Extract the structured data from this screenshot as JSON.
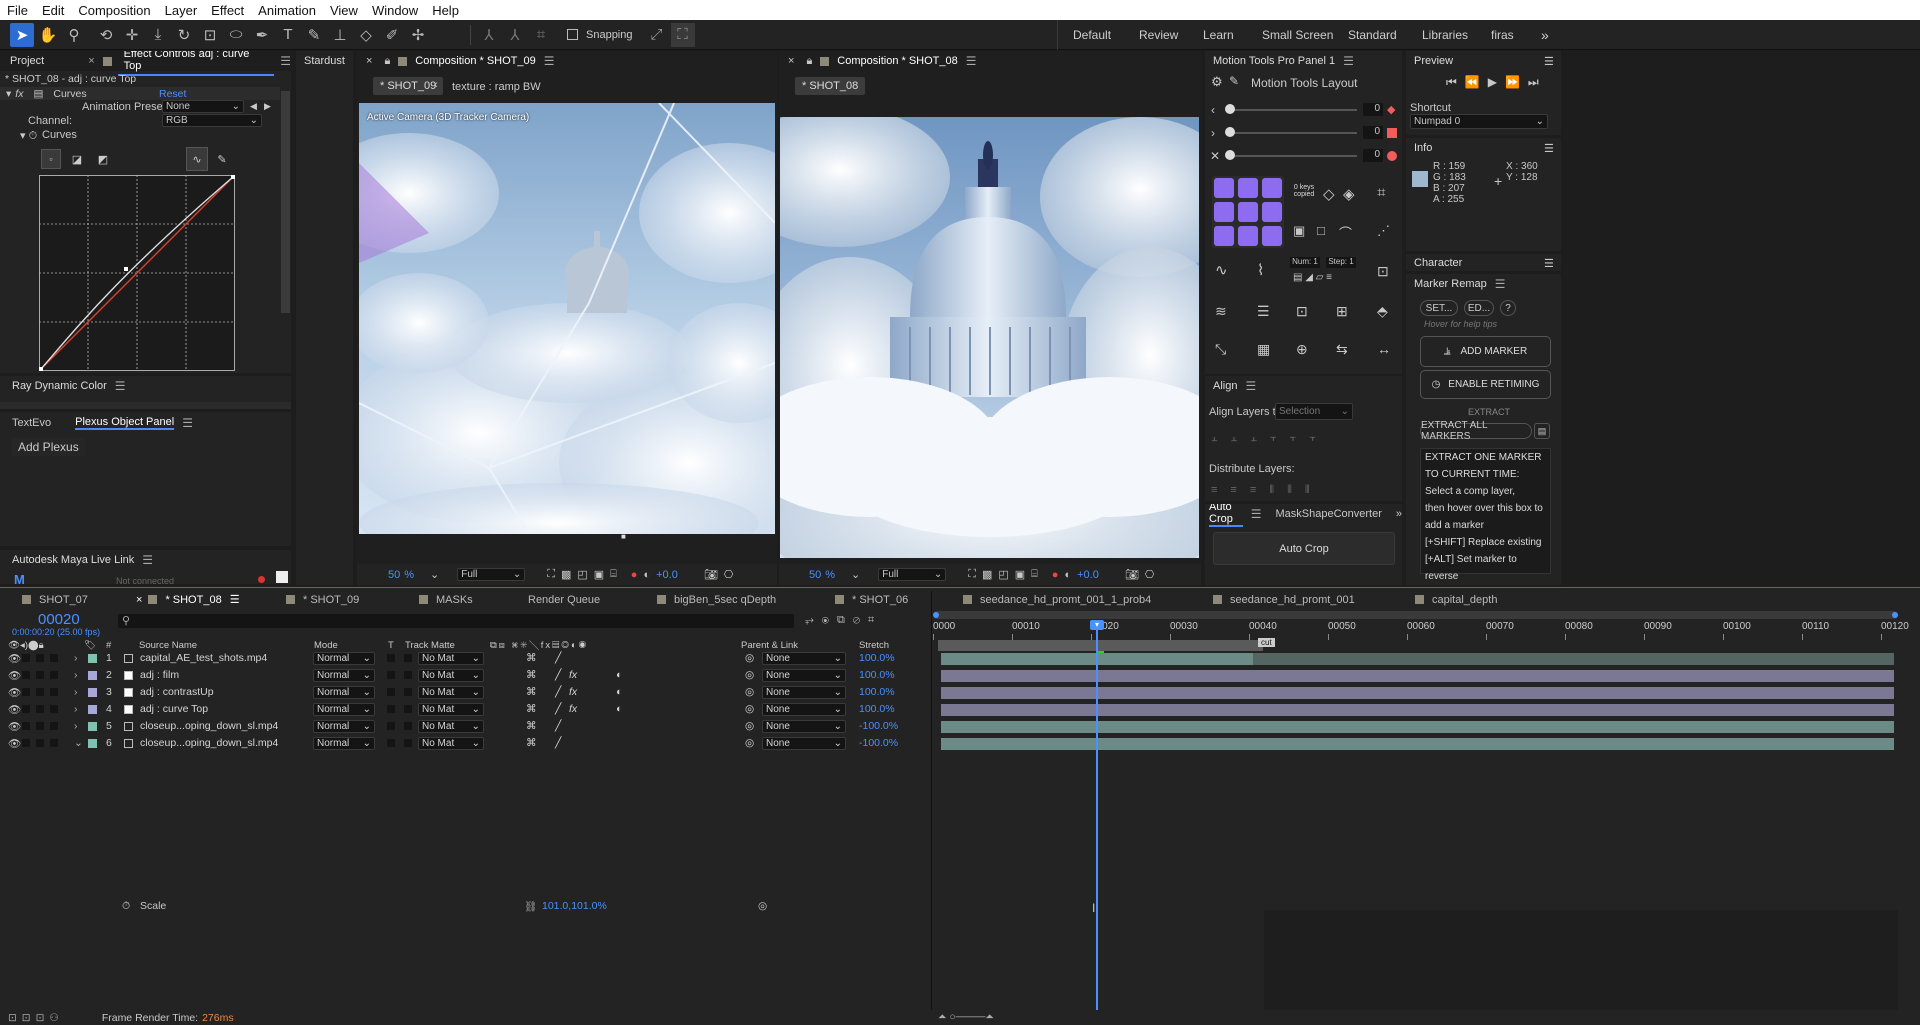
{
  "menu": [
    "File",
    "Edit",
    "Composition",
    "Layer",
    "Effect",
    "Animation",
    "View",
    "Window",
    "Help"
  ],
  "toolbar": {
    "snapping": "Snapping"
  },
  "workspaces": [
    "Default",
    "Review",
    "Learn",
    "Small Screen",
    "Standard",
    "Libraries",
    "firas"
  ],
  "left_panel": {
    "tab_project": "Project",
    "tab_effect_controls": "Effect Controls adj : curve Top",
    "subtitle": "* SHOT_08 - adj : curve Top",
    "effect_name": "Curves",
    "reset": "Reset",
    "presets_label": "Animation Presets:",
    "presets_value": "None",
    "channel_label": "Channel:",
    "channel_value": "RGB",
    "curves_label": "Curves"
  },
  "stardust": "Stardust",
  "ray": {
    "title": "Ray Dynamic Color"
  },
  "plexus": {
    "tab1": "TextEvo",
    "tab2": "Plexus Object Panel",
    "add": "Add Plexus"
  },
  "maya": {
    "title": "Autodesk Maya Live Link",
    "status": "Not connected"
  },
  "comp1": {
    "title": "Composition * SHOT_09",
    "pill": "* SHOT_09",
    "crumb": "texture : ramp BW",
    "camera": "Active Camera (3D Tracker Camera)",
    "zoom": "50",
    "zoom_unit": "%",
    "res": "Full",
    "exposure": "+0.0"
  },
  "comp2": {
    "title": "Composition * SHOT_08",
    "pill": "* SHOT_08",
    "zoom": "50",
    "zoom_unit": "%",
    "res": "Full",
    "exposure": "+0.0"
  },
  "motion_tools": {
    "title": "Motion Tools Pro Panel 1",
    "layout": "Motion Tools Layout",
    "sliders": [
      "0",
      "0",
      "0"
    ],
    "keys_copied": "0 keys copied",
    "num": "Num: 1",
    "step": "Step: 1"
  },
  "align": {
    "title": "Align",
    "align_to": "Align Layers to:",
    "selection": "Selection",
    "distribute": "Distribute Layers:"
  },
  "autocrop": {
    "tab1": "Auto Crop",
    "tab2": "MaskShapeConverter",
    "button": "Auto Crop"
  },
  "preview": {
    "title": "Preview",
    "shortcut_label": "Shortcut",
    "shortcut_value": "Numpad 0"
  },
  "info": {
    "title": "Info",
    "r": "R : 159",
    "g": "G : 183",
    "b": "B : 207",
    "a": "A : 255",
    "x": "X : 360",
    "y": "Y : 128"
  },
  "character": {
    "title": "Character"
  },
  "marker": {
    "title": "Marker Remap",
    "set": "SET...",
    "ed": "ED...",
    "help": "?",
    "hover": "Hover for help tips",
    "add": "ADD MARKER",
    "enable": "ENABLE RETIMING",
    "extract": "EXTRACT",
    "extract_all": "EXTRACT ALL MARKERS",
    "notes": [
      "EXTRACT ONE MARKER",
      "TO CURRENT TIME:",
      "Select a comp layer,",
      "then hover over this box to",
      "add a marker",
      "[+SHIFT] Replace existing",
      "[+ALT] Set marker to reverse"
    ]
  },
  "timeline": {
    "tabs": [
      "SHOT_07",
      "* SHOT_08",
      "* SHOT_09",
      "MASKs",
      "Render Queue",
      "bigBen_5sec qDepth",
      "* SHOT_06",
      "seedance_hd_promt_001_1_prob4",
      "seedance_hd_promt_001",
      "capital_depth"
    ],
    "timecode": "00020",
    "fps": "0:00:00:20 (25.00 fps)",
    "cols": {
      "num": "#",
      "source": "Source Name",
      "mode": "Mode",
      "t": "T",
      "matte": "Track Matte",
      "parent": "Parent & Link",
      "stretch": "Stretch"
    },
    "layers": [
      {
        "n": "1",
        "name": "capital_AE_test_shots.mp4",
        "mode": "Normal",
        "matte": "No Mat",
        "parent": "None",
        "stretch": "100.0%",
        "color": "#7ec2b0"
      },
      {
        "n": "2",
        "name": "adj : film",
        "mode": "Normal",
        "matte": "No Mat",
        "parent": "None",
        "stretch": "100.0%",
        "color": "#a8a8d8"
      },
      {
        "n": "3",
        "name": "adj : contrastUp",
        "mode": "Normal",
        "matte": "No Mat",
        "parent": "None",
        "stretch": "100.0%",
        "color": "#a8a8d8"
      },
      {
        "n": "4",
        "name": "adj : curve Top",
        "mode": "Normal",
        "matte": "No Mat",
        "parent": "None",
        "stretch": "100.0%",
        "color": "#a8a8d8"
      },
      {
        "n": "5",
        "name": "closeup...oping_down_sl.mp4",
        "mode": "Normal",
        "matte": "No Mat",
        "parent": "None",
        "stretch": "-100.0%",
        "color": "#7ec2b0"
      },
      {
        "n": "6",
        "name": "closeup...oping_down_sl.mp4",
        "mode": "Normal",
        "matte": "No Mat",
        "parent": "None",
        "stretch": "-100.0%",
        "color": "#7ec2b0"
      }
    ],
    "scale_label": "Scale",
    "scale_value": "101.0,101.0%",
    "ruler": [
      "0000",
      "00010",
      "00020",
      "00030",
      "00040",
      "00050",
      "00060",
      "00070",
      "00080",
      "00090",
      "00100",
      "00110",
      "00120"
    ],
    "cut": "cut",
    "render_label": "Frame Render Time:",
    "render_value": "276ms"
  }
}
